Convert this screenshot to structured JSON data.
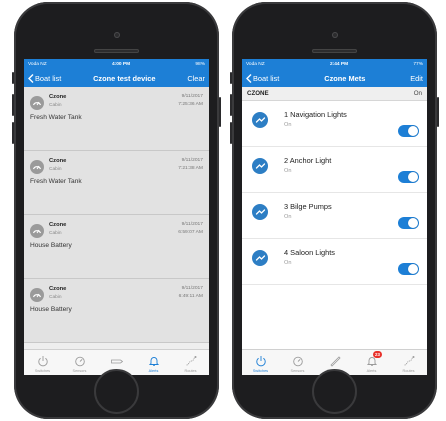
{
  "left_phone": {
    "status": {
      "carrier": "Voda NZ",
      "time": "4:00 PM",
      "battery": "98%"
    },
    "nav": {
      "back_label": "Boat list",
      "title": "Czone test device",
      "action": "Clear"
    },
    "alerts": [
      {
        "source": "Czone",
        "zone": "Cabin",
        "date": "9/11/2017",
        "time": "7:25:36 AM",
        "message": "Fresh Water Tank"
      },
      {
        "source": "Czone",
        "zone": "Cabin",
        "date": "9/11/2017",
        "time": "7:21:38 AM",
        "message": "Fresh Water Tank"
      },
      {
        "source": "Czone",
        "zone": "Cabin",
        "date": "9/11/2017",
        "time": "6:59:07 AM",
        "message": "House Battery"
      },
      {
        "source": "Czone",
        "zone": "Cabin",
        "date": "9/11/2017",
        "time": "6:49:11 AM",
        "message": "House Battery"
      }
    ],
    "tabs": [
      {
        "label": "Switches",
        "icon": "power-icon",
        "active": false
      },
      {
        "label": "Sensors",
        "icon": "gauge-icon",
        "active": false
      },
      {
        "label": "Overview",
        "icon": "boat-icon",
        "active": false
      },
      {
        "label": "Alerts",
        "icon": "bell-icon",
        "active": true
      },
      {
        "label": "Routes",
        "icon": "route-icon",
        "active": false
      }
    ]
  },
  "right_phone": {
    "status": {
      "carrier": "Voda NZ",
      "time": "2:44 PM",
      "battery": "77%"
    },
    "nav": {
      "back_label": "Boat list",
      "title": "Czone Mets",
      "action": "Edit"
    },
    "zone": {
      "title": "CZONE",
      "state": "On"
    },
    "switches": [
      {
        "name": "1 Navigation Lights",
        "state": "On",
        "on": true
      },
      {
        "name": "2 Anchor Light",
        "state": "On",
        "on": true
      },
      {
        "name": "3 Bilge Pumps",
        "state": "On",
        "on": true
      },
      {
        "name": "4 Saloon Lights",
        "state": "On",
        "on": true
      }
    ],
    "tabs": [
      {
        "label": "Switches",
        "icon": "power-icon",
        "active": true
      },
      {
        "label": "Sensors",
        "icon": "gauge-icon",
        "active": false
      },
      {
        "label": "Overview",
        "icon": "boat-icon",
        "active": false
      },
      {
        "label": "Alerts",
        "icon": "bell-icon",
        "active": false,
        "badge": "23"
      },
      {
        "label": "Routes",
        "icon": "route-icon",
        "active": false
      }
    ]
  },
  "colors": {
    "accent": "#1d7fd6",
    "badge": "#e8312a",
    "alert_row": "#e2e2e2"
  }
}
